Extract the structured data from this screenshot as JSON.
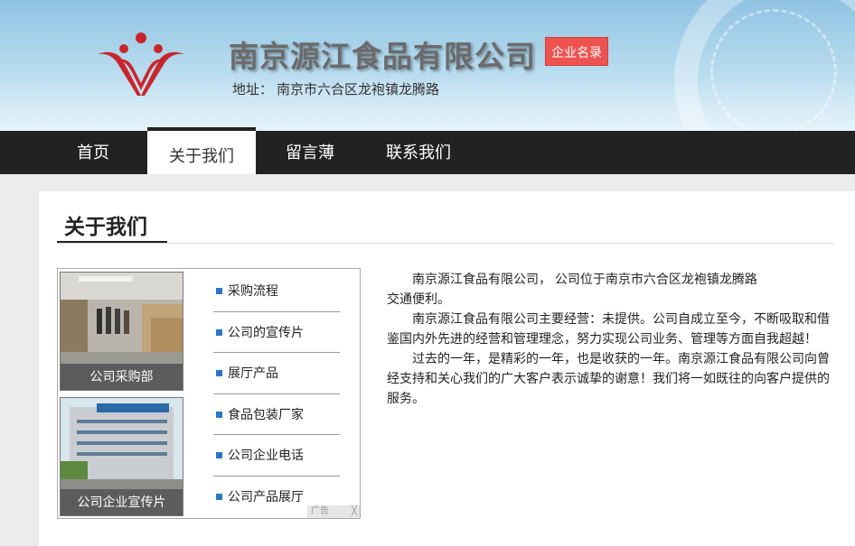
{
  "header": {
    "company_name": "南京源江食品有限公司",
    "badge_label": "企业名录",
    "address_label": "地址：",
    "address_value": "南京市六合区龙袍镇龙腾路"
  },
  "nav": {
    "items": [
      {
        "label": "首页"
      },
      {
        "label": "关于我们",
        "active": true
      },
      {
        "label": "留言薄"
      },
      {
        "label": "联系我们"
      }
    ]
  },
  "section": {
    "title": "关于我们"
  },
  "ad": {
    "photos": [
      {
        "caption": "公司采购部"
      },
      {
        "caption": "公司企业宣传片"
      }
    ],
    "links": [
      {
        "label": "采购流程"
      },
      {
        "label": "公司的宣传片"
      },
      {
        "label": "展厅产品"
      },
      {
        "label": "食品包装厂家"
      },
      {
        "label": "公司企业电话"
      },
      {
        "label": "公司产品展厅"
      }
    ],
    "tag_label": "广告",
    "tag_close": "╳"
  },
  "intro": {
    "p1": "南京源江食品有限公司， 公司位于南京市六合区龙袍镇龙腾路",
    "p1b": "交通便利。",
    "p2": "南京源江食品有限公司主要经营：未提供。公司自成立至今，不断吸取和借鉴国内外先进的经营和管理理念，努力实现公司业务、管理等方面自我超越！",
    "p3": "过去的一年，是精彩的一年，也是收获的一年。南京源江食品有限公司向曾经支持和关心我们的广大客户表示诚挚的谢意！我们将一如既往的向客户提供的服务。"
  },
  "colors": {
    "nav_bg": "#222222",
    "badge": "#ee5350",
    "bullet": "#2a76c6",
    "logo_red": "#c8262c"
  }
}
